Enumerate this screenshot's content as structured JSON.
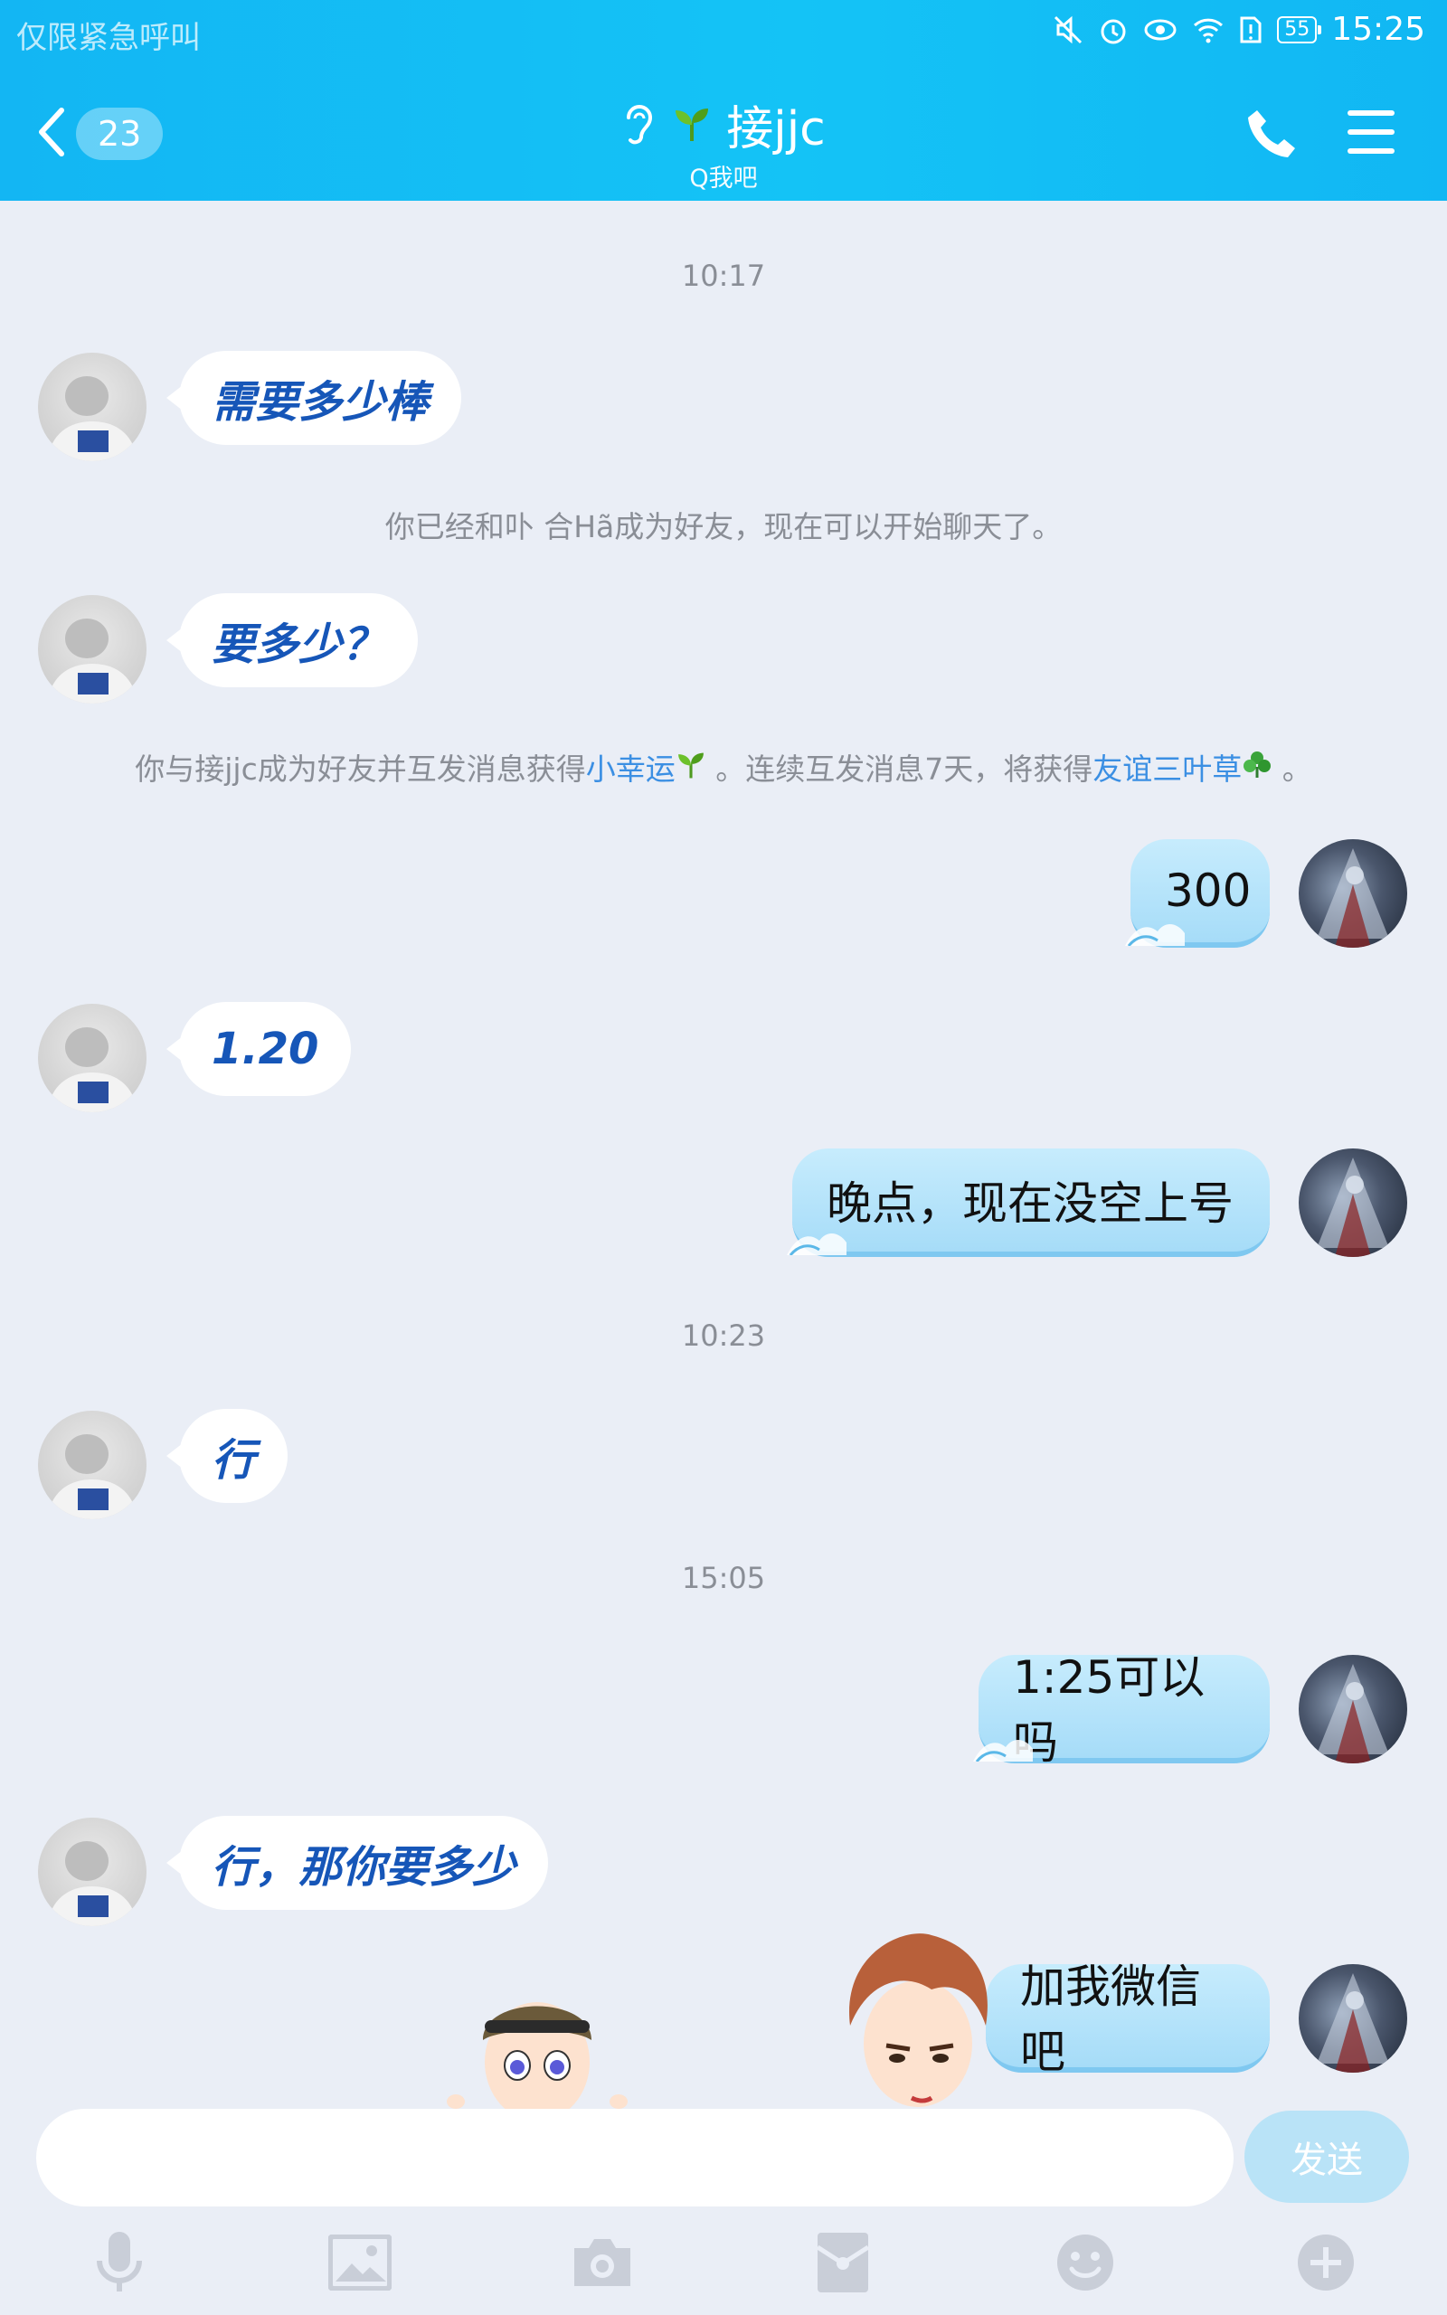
{
  "status_bar": {
    "carrier": "仅限紧急呼叫",
    "battery": "55",
    "time": "15:25",
    "icons": [
      "mute-icon",
      "alarm-icon",
      "eye-icon",
      "wifi-icon",
      "sim-alert-icon",
      "battery-icon"
    ]
  },
  "header": {
    "unread_count": "23",
    "name": "接jjc",
    "subtitle": "Q我吧",
    "icons": [
      "back-icon",
      "earpiece-icon",
      "sprout-icon",
      "phone-icon",
      "menu-icon"
    ]
  },
  "messages": [
    {
      "type": "time",
      "text": "10:17"
    },
    {
      "type": "in",
      "text": "需要多少棒"
    },
    {
      "type": "system",
      "text": "你已经和卟 合Hã成为好友，现在可以开始聊天了。"
    },
    {
      "type": "in",
      "text": "要多少？"
    },
    {
      "type": "system_rich",
      "parts": [
        "你与接jjc成为好友并互发消息获得",
        "小幸运",
        " 。连续互发消息7天，将获得",
        "友谊三叶草",
        " 。"
      ]
    },
    {
      "type": "out",
      "text": "300"
    },
    {
      "type": "in",
      "text": "1.20"
    },
    {
      "type": "out",
      "text": "晚点，现在没空上号"
    },
    {
      "type": "time",
      "text": "10:23"
    },
    {
      "type": "in",
      "text": "行"
    },
    {
      "type": "time",
      "text": "15:05"
    },
    {
      "type": "out",
      "text": "1:25可以吗"
    },
    {
      "type": "in",
      "text": "行，那你要多少"
    },
    {
      "type": "out",
      "text": "加我微信吧"
    }
  ],
  "input": {
    "placeholder": "",
    "value": ""
  },
  "send_label": "发送",
  "toolbar": [
    "microphone-icon",
    "image-icon",
    "camera-icon",
    "red-packet-icon",
    "emoji-icon",
    "plus-icon"
  ],
  "colors": {
    "header": "#14c3f6",
    "incoming_text": "#1656b8",
    "link": "#3b8fe3",
    "background": "#eaeef6"
  }
}
